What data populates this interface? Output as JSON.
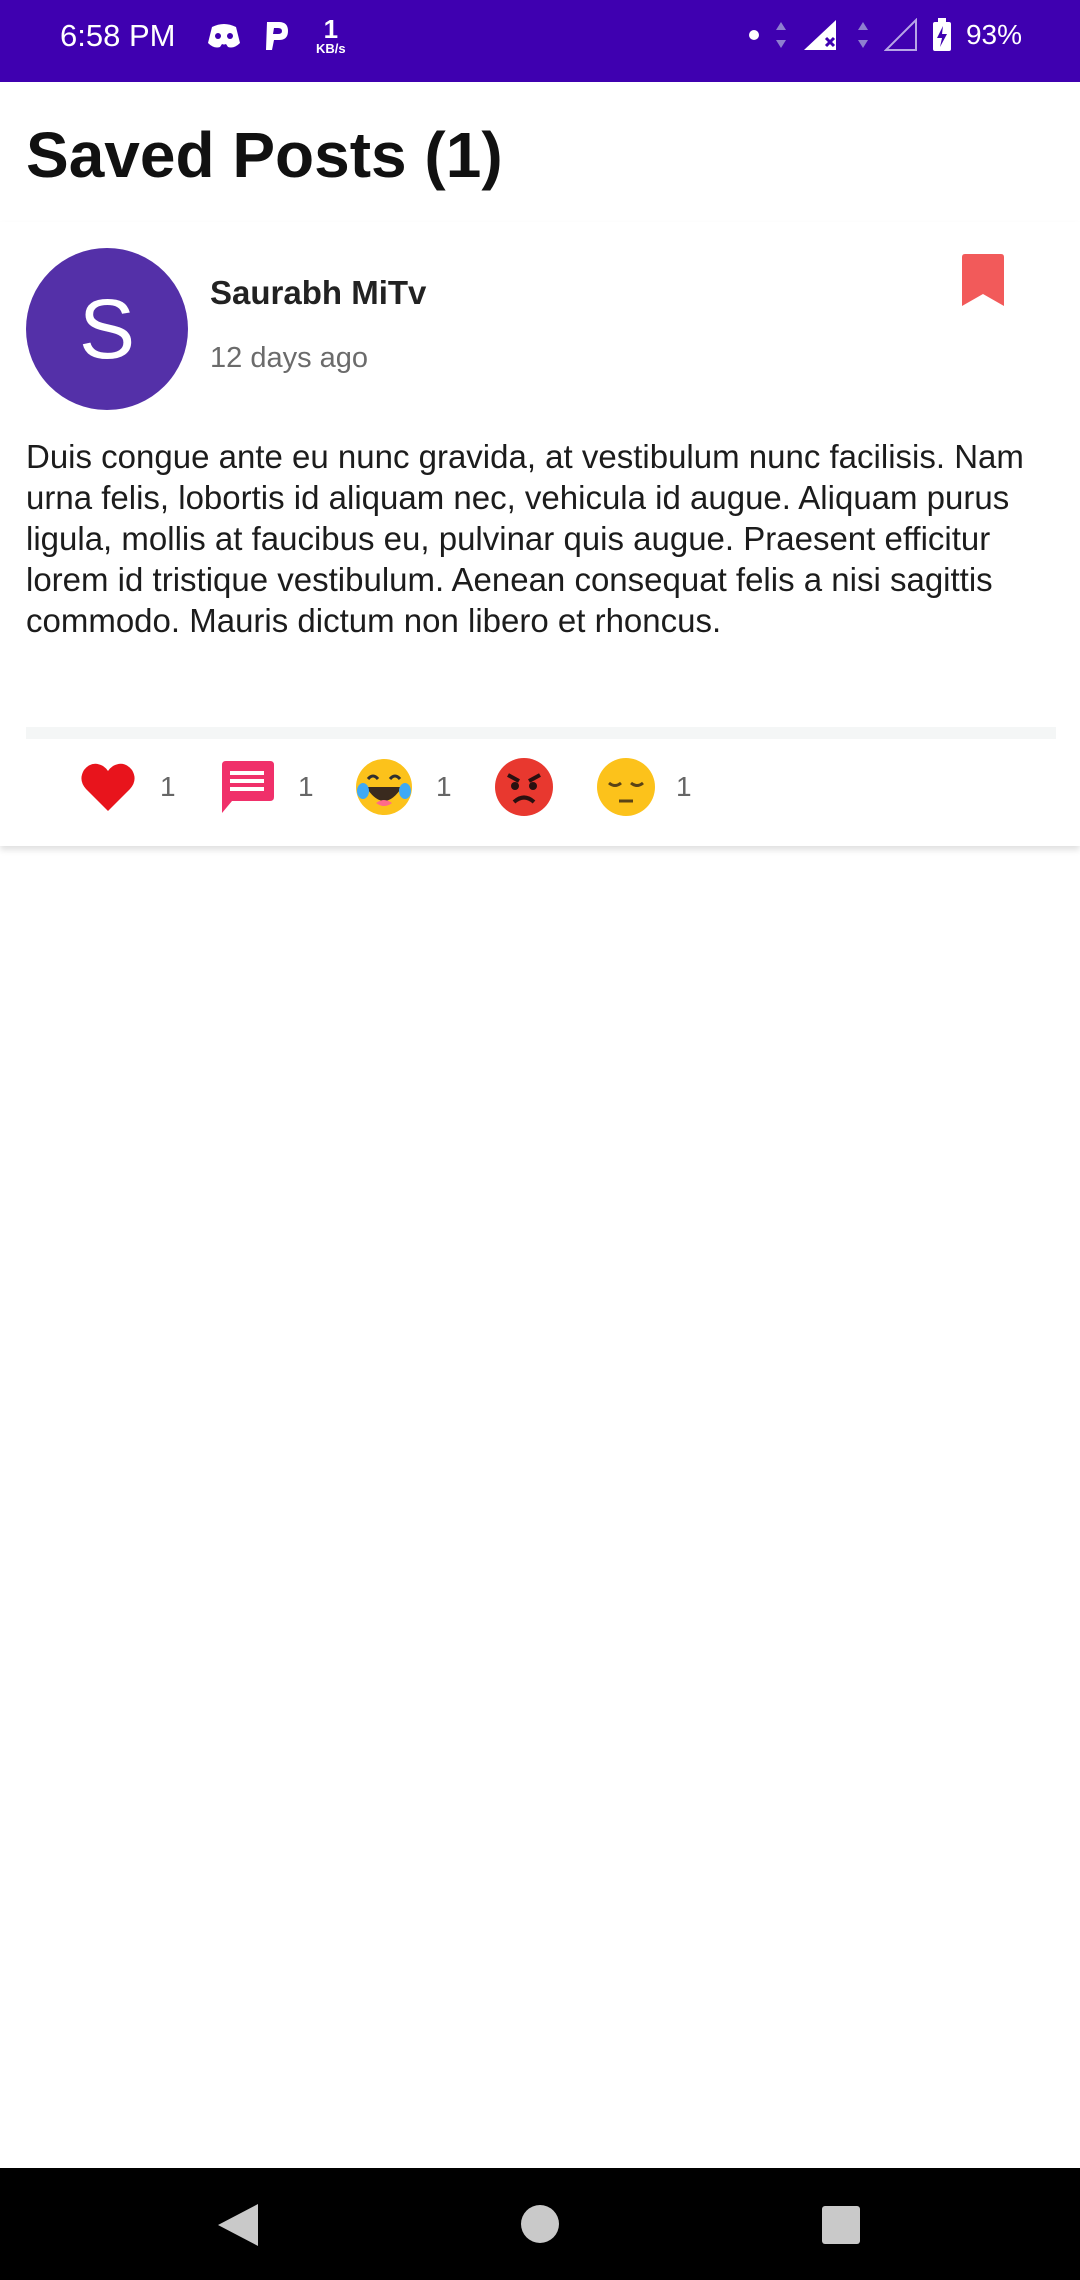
{
  "status_bar": {
    "time": "6:58 PM",
    "net_speed_value": "1",
    "net_speed_unit": "KB/s",
    "battery": "93%"
  },
  "page": {
    "title": "Saved Posts (1)"
  },
  "post": {
    "avatar_letter": "S",
    "author": "Saurabh MiTv",
    "time_ago": "12 days ago",
    "body": "Duis congue ante eu nunc gravida, at vestibulum nunc facilisis. Nam urna felis, lobortis id aliquam nec, vehicula id augue. Aliquam purus ligula, mollis at faucibus eu, pulvinar quis augue. Praesent efficitur lorem id tristique vestibulum. Aenean consequat felis a nisi sagittis commodo. Mauris dictum non libero et rhoncus.",
    "bookmark_icon": "bookmark-icon",
    "reactions": [
      {
        "icon": "heart-icon",
        "count": "1"
      },
      {
        "icon": "comment-icon",
        "count": "1"
      },
      {
        "icon": "laughing-emoji-icon",
        "count": "1"
      },
      {
        "icon": "angry-emoji-icon",
        "count": ""
      },
      {
        "icon": "sad-emoji-icon",
        "count": "1"
      }
    ]
  },
  "colors": {
    "status_bar": "#3f00b0",
    "avatar": "#5430a8",
    "bookmark": "#f25a5a",
    "heart": "#e8141c",
    "comment": "#f0306a",
    "nav_bar": "#000000"
  }
}
